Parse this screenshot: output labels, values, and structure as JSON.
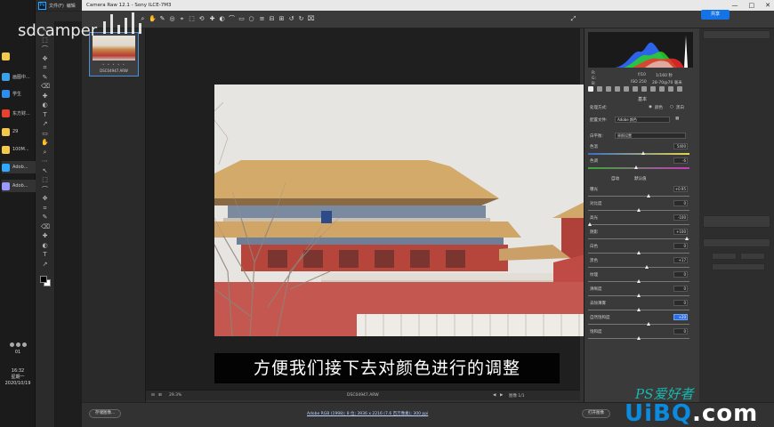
{
  "watermark": {
    "text": "sdcamper"
  },
  "taskbar": {
    "items": [
      {
        "label": "",
        "color": "#f2c94c"
      },
      {
        "label": "画图中...",
        "color": "#3aa0e8"
      },
      {
        "label": "学生",
        "color": "#2d8cf0"
      },
      {
        "label": "东方财...",
        "color": "#e8412d"
      },
      {
        "label": "29",
        "color": "#f2c94c"
      },
      {
        "label": "100M...",
        "color": "#f2c94c"
      },
      {
        "label": "Adob...",
        "color": "#31a8ff"
      },
      {
        "label": "Adob...",
        "color": "#9999ff"
      }
    ],
    "tray_counter": "01",
    "time": "16:32",
    "weekday": "星期一",
    "date": "2020/10/19"
  },
  "ps": {
    "logo": "Ps",
    "menu": [
      "文件(F)",
      "编辑"
    ],
    "share_label": "共享"
  },
  "camera_raw": {
    "title": "Camera Raw 12.1 - Sony ILCE-7M3",
    "thumb_label": "DSC04947.ARW",
    "thumb_stars": "• • • • •",
    "zoom": "29.3%",
    "filename": "DSC04947.ARW",
    "image_counter": "图像 1/1",
    "save_button": "存储图像...",
    "open_button": "打开图像",
    "info_link": "Adobe RGB (1998); 8 位; 3936 x 2216 (7.6 百万像素); 300 ppi",
    "subtitle": "方便我们接下去对颜色进行的调整",
    "cam_info": {
      "f": "f/10",
      "shutter": "1/160 秒",
      "iso": "ISO 250",
      "lens": "28-70@70 毫米",
      "r": "R:",
      "g": "G:",
      "b": "B:"
    },
    "panel_title": "基本",
    "process_label": "处理方式:",
    "color_label": "颜色",
    "bw_label": "黑白",
    "profile_label": "配置文件:",
    "profile_value": "Adobe 颜色",
    "wb_label": "白平衡:",
    "wb_value": "原照设置",
    "auto_label": "自动",
    "default_label": "默认值",
    "sliders": [
      {
        "label": "色温",
        "value": "5400",
        "pos": 0.55,
        "kind": "temp"
      },
      {
        "label": "色调",
        "value": "-6",
        "pos": 0.48,
        "kind": "tint"
      },
      {
        "label": "曝光",
        "value": "+0.95",
        "pos": 0.6,
        "kind": "plain"
      },
      {
        "label": "对比度",
        "value": "0",
        "pos": 0.5,
        "kind": "plain"
      },
      {
        "label": "高光",
        "value": "-100",
        "pos": 0.02,
        "kind": "plain"
      },
      {
        "label": "阴影",
        "value": "+100",
        "pos": 0.98,
        "kind": "plain"
      },
      {
        "label": "白色",
        "value": "0",
        "pos": 0.5,
        "kind": "plain"
      },
      {
        "label": "黑色",
        "value": "+17",
        "pos": 0.58,
        "kind": "plain"
      },
      {
        "label": "纹理",
        "value": "0",
        "pos": 0.5,
        "kind": "plain"
      },
      {
        "label": "清晰度",
        "value": "0",
        "pos": 0.5,
        "kind": "plain"
      },
      {
        "label": "去除薄雾",
        "value": "0",
        "pos": 0.5,
        "kind": "plain"
      },
      {
        "label": "自然饱和度",
        "value": "+20",
        "pos": 0.6,
        "kind": "plain",
        "highlight": true
      },
      {
        "label": "饱和度",
        "value": "0",
        "pos": 0.5,
        "kind": "plain"
      }
    ]
  },
  "brand": {
    "ps": "PS爱好者",
    "uibq": "UiBQ",
    "com": ".com"
  }
}
